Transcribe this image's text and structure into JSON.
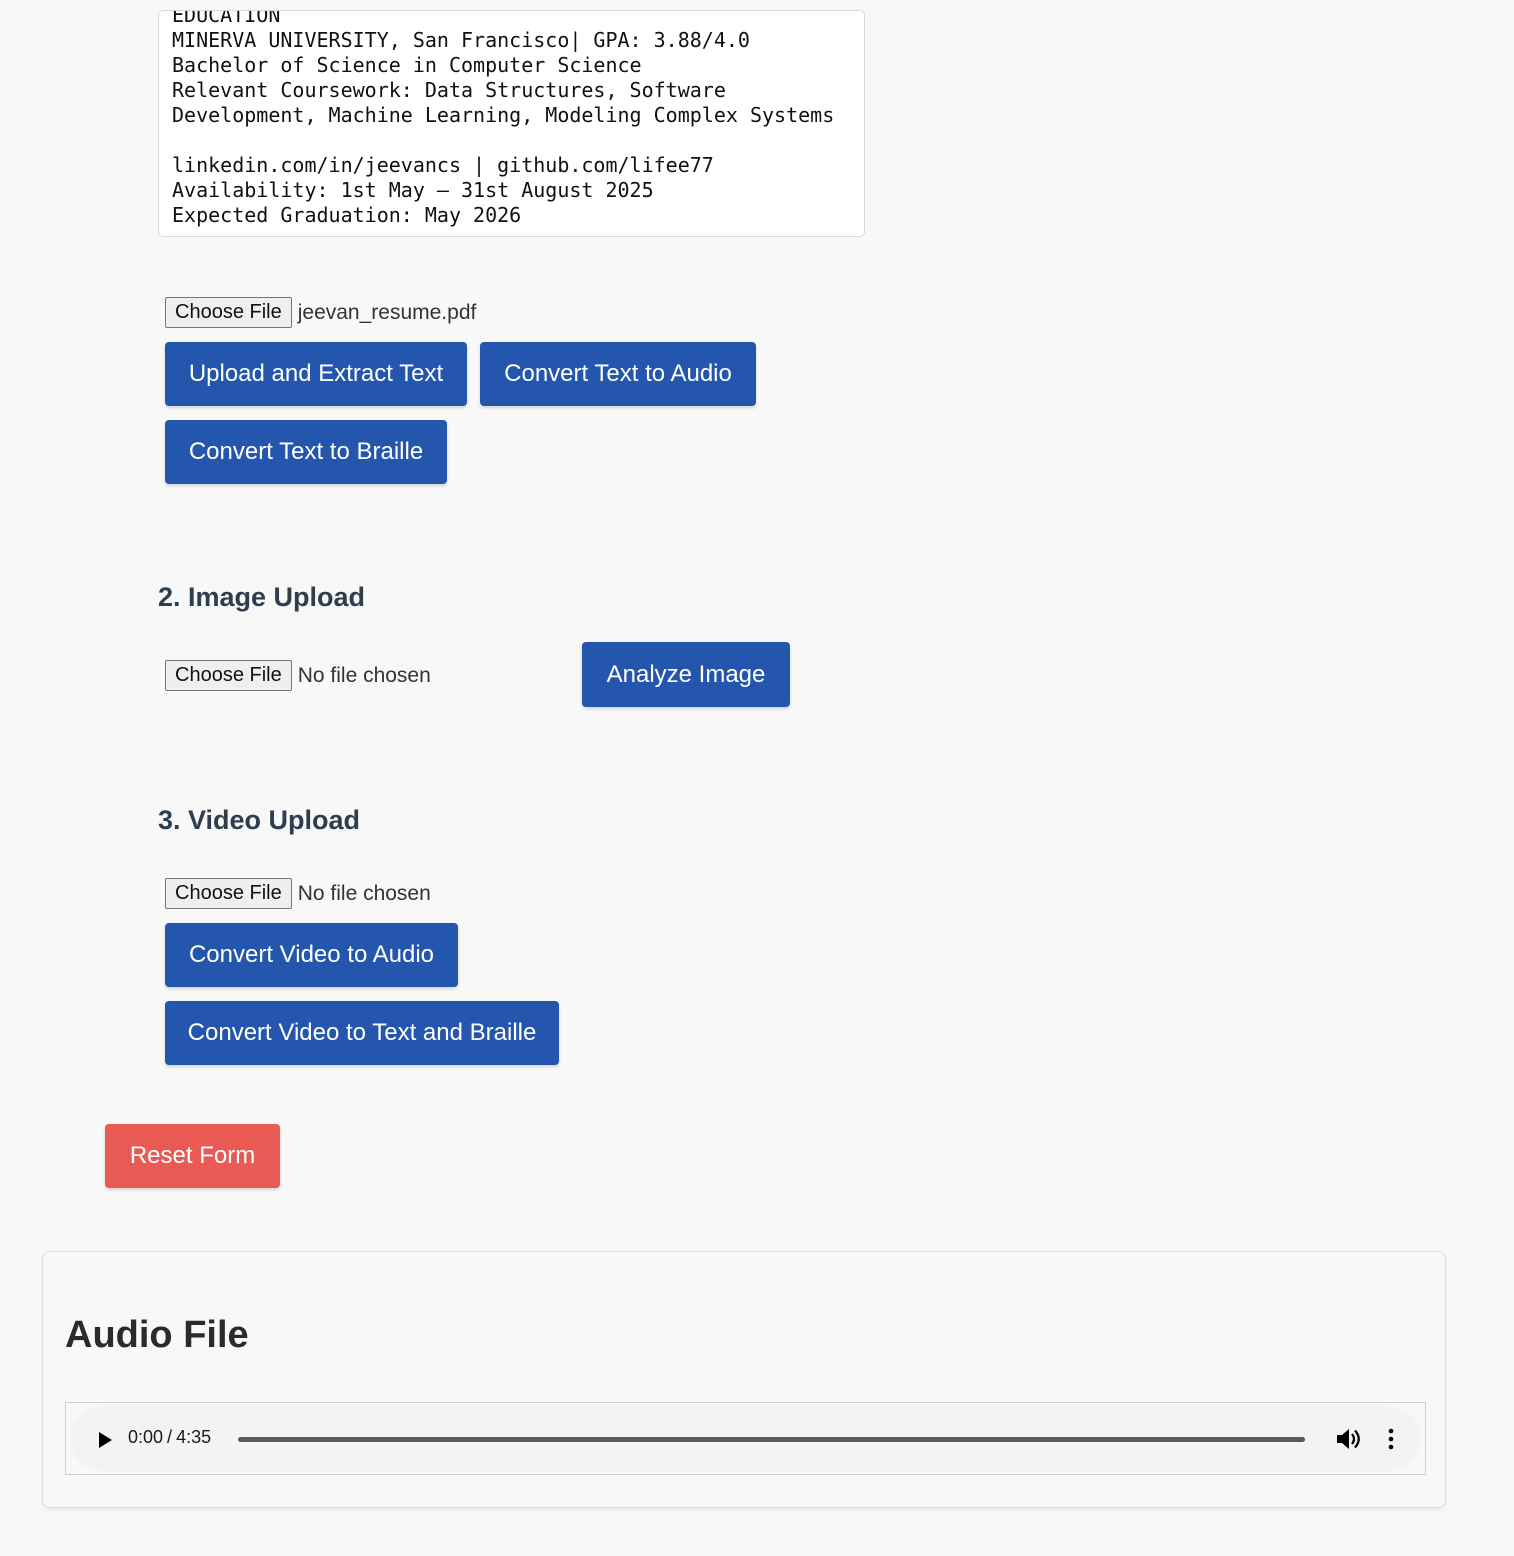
{
  "text_section": {
    "extracted_text": "EDUCATION\nMINERVA UNIVERSITY, San Francisco| GPA: 3.88/4.0\nBachelor of Science in Computer Science\nRelevant Coursework: Data Structures, Software Development, Machine Learning, Modeling Complex Systems\n\nlinkedin.com/in/jeevancs | github.com/lifee77\nAvailability: 1st May – 31st August 2025\nExpected Graduation: May 2026",
    "choose_file_label": "Choose File",
    "file_name": "jeevan_resume.pdf",
    "upload_button": "Upload and Extract Text",
    "audio_button": "Convert Text to Audio",
    "braille_button": "Convert Text to Braille"
  },
  "image_section": {
    "title": "2. Image Upload",
    "choose_file_label": "Choose File",
    "file_name": "No file chosen",
    "analyze_button": "Analyze Image"
  },
  "video_section": {
    "title": "3. Video Upload",
    "choose_file_label": "Choose File",
    "file_name": "No file chosen",
    "audio_button": "Convert Video to Audio",
    "text_braille_button": "Convert Video to Text and Braille"
  },
  "reset_button": "Reset Form",
  "audio_card": {
    "title": "Audio File",
    "current_time": "0:00",
    "time_separator": "/",
    "duration": "4:35",
    "progress_fraction": 0
  },
  "colors": {
    "primary_button": "#2456ad",
    "reset_button": "#ea5a55",
    "heading": "#2c3e50"
  },
  "icons": [
    "play-icon",
    "volume-icon",
    "more-options-icon"
  ]
}
